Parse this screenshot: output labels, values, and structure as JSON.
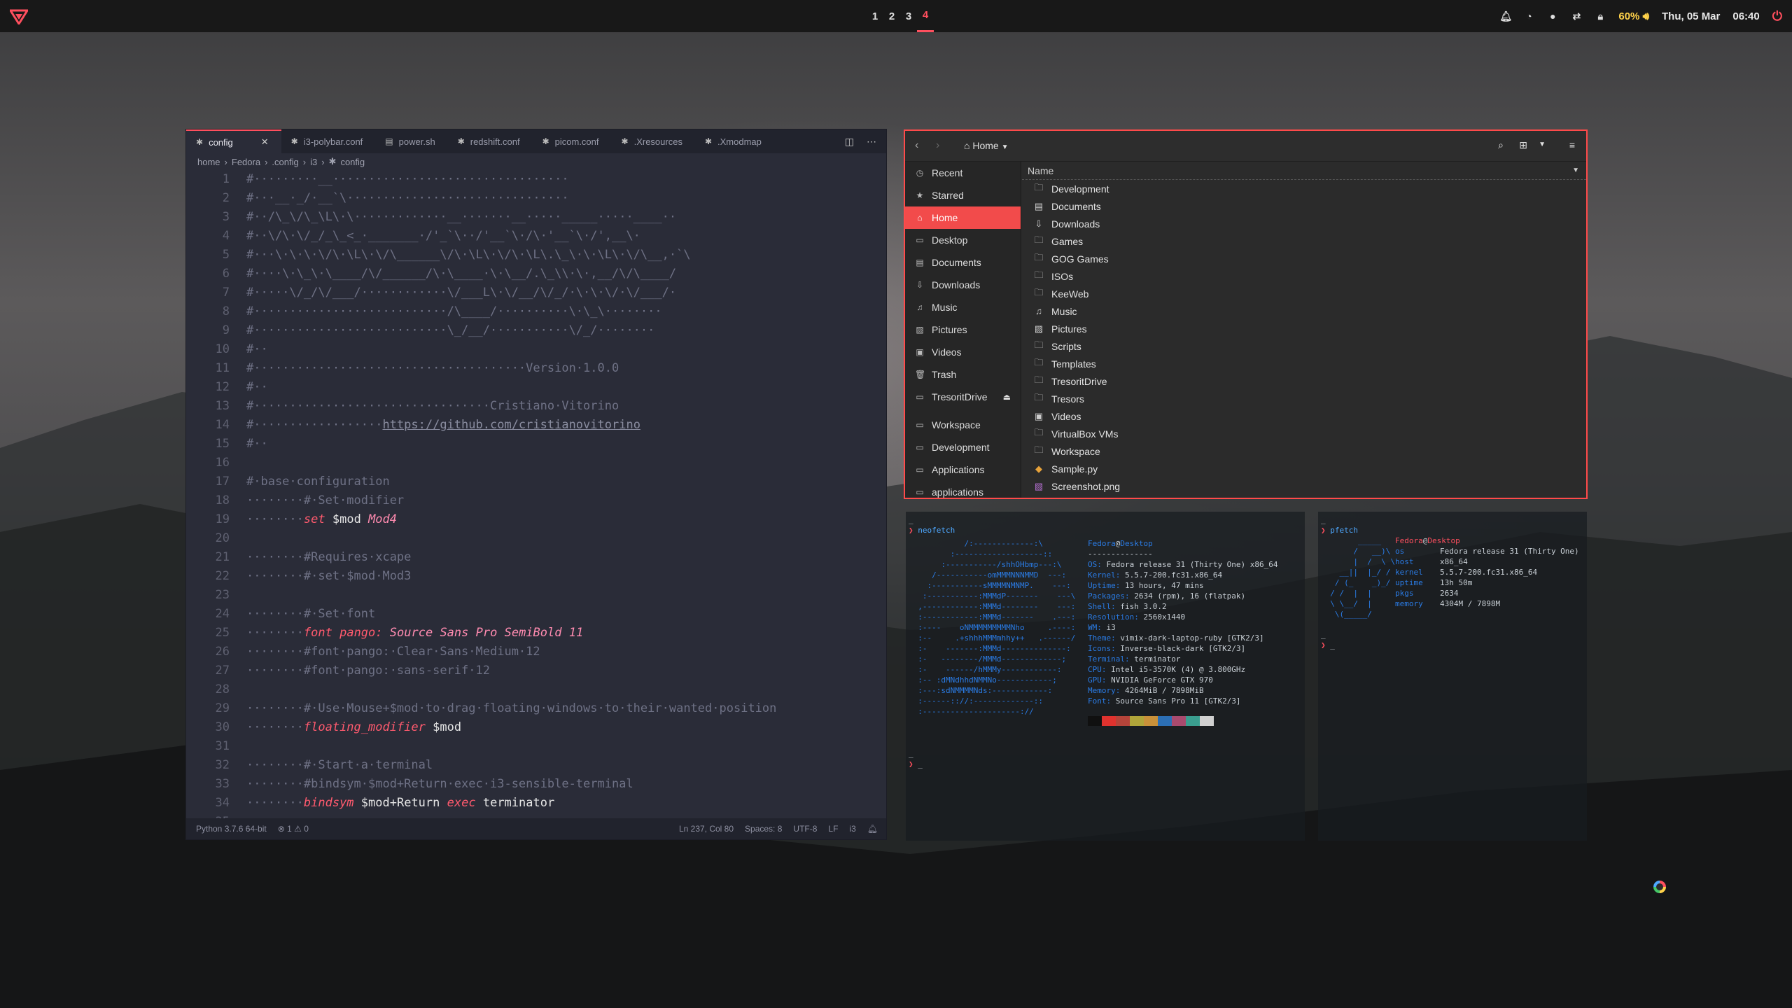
{
  "topbar": {
    "workspaces": [
      "1",
      "2",
      "3",
      "4"
    ],
    "active_workspace": "4",
    "tray_icons": [
      "bell-icon",
      "timer-icon",
      "circle-icon",
      "share-icon",
      "lock-icon"
    ],
    "volume": "60%",
    "date": "Thu, 05 Mar",
    "time": "06:40",
    "accent": "#ff4f5e"
  },
  "editor": {
    "tabs": [
      {
        "icon": "gear-icon",
        "label": "config",
        "active": true
      },
      {
        "icon": "gear-icon",
        "label": "i3-polybar.conf"
      },
      {
        "icon": "shell-icon",
        "label": "power.sh"
      },
      {
        "icon": "gear-icon",
        "label": "redshift.conf"
      },
      {
        "icon": "gear-icon",
        "label": "picom.conf"
      },
      {
        "icon": "gear-icon",
        "label": ".Xresources"
      },
      {
        "icon": "gear-icon",
        "label": ".Xmodmap"
      }
    ],
    "breadcrumb": [
      "home",
      "Fedora",
      ".config",
      "i3",
      "config"
    ],
    "lines": [
      {
        "n": "1",
        "text": "#·········__·································"
      },
      {
        "n": "2",
        "text": "#···__·_/·__`\\·······························"
      },
      {
        "n": "3",
        "text": "#··/\\_\\/\\_\\L\\·\\·············__·······__·····_____·····____··"
      },
      {
        "n": "4",
        "text": "#··\\/\\·\\/_/_\\_<_·_______·/'_`\\··/'__`\\·/\\·'__`\\·/',__\\·"
      },
      {
        "n": "5",
        "text": "#···\\·\\·\\·\\/\\·\\L\\·\\/\\______\\/\\·\\L\\·\\/\\·\\L\\.\\_\\·\\·\\L\\·\\/\\__,·`\\"
      },
      {
        "n": "6",
        "text": "#····\\·\\_\\·\\____/\\/______/\\·\\____·\\·\\__/.\\_\\\\·\\·,__/\\/\\____/"
      },
      {
        "n": "7",
        "text": "#·····\\/_/\\/___/············\\/___L\\·\\/__/\\/_/·\\·\\·\\/·\\/___/·"
      },
      {
        "n": "8",
        "text": "#···························/\\____/··········\\·\\_\\········"
      },
      {
        "n": "9",
        "text": "#···························\\_/__/···········\\/_/········"
      },
      {
        "n": "10",
        "text": "#··"
      },
      {
        "n": "11",
        "text": "#······································Version·1.0.0"
      },
      {
        "n": "12",
        "text": "#··"
      },
      {
        "n": "13",
        "text": "#·································Cristiano·Vitorino"
      },
      {
        "n": "14",
        "text": "#··················https://github.com/cristianovitorino"
      },
      {
        "n": "15",
        "text": "#··"
      },
      {
        "n": "16",
        "text": ""
      },
      {
        "n": "17",
        "text": "#·base·configuration"
      },
      {
        "n": "18",
        "text": "········#·Set·modifier"
      },
      {
        "n": "19",
        "text": "········set $mod Mod4"
      },
      {
        "n": "20",
        "text": ""
      },
      {
        "n": "21",
        "text": "········#Requires·xcape"
      },
      {
        "n": "22",
        "text": "········#·set·$mod·Mod3"
      },
      {
        "n": "23",
        "text": ""
      },
      {
        "n": "24",
        "text": "········#·Set·font"
      },
      {
        "n": "25",
        "text": "········font pango: Source Sans Pro SemiBold 11"
      },
      {
        "n": "26",
        "text": "········#font·pango:·Clear·Sans·Medium·12"
      },
      {
        "n": "27",
        "text": "········#font·pango:·sans-serif·12"
      },
      {
        "n": "28",
        "text": ""
      },
      {
        "n": "29",
        "text": "········#·Use·Mouse+$mod·to·drag·floating·windows·to·their·wanted·position"
      },
      {
        "n": "30",
        "text": "········floating_modifier $mod"
      },
      {
        "n": "31",
        "text": ""
      },
      {
        "n": "32",
        "text": "········#·Start·a·terminal"
      },
      {
        "n": "33",
        "text": "········#bindsym·$mod+Return·exec·i3-sensible-terminal"
      },
      {
        "n": "34",
        "text": "········bindsym $mod+Return exec terminator"
      },
      {
        "n": "35",
        "text": ""
      }
    ],
    "status": {
      "python": "Python 3.7.6 64-bit",
      "problems": "⊗ 1 ⚠ 0",
      "position": "Ln 237, Col 80",
      "spaces": "Spaces: 8",
      "encoding": "UTF-8",
      "eol": "LF",
      "lang": "i3"
    }
  },
  "filemanager": {
    "location": "Home",
    "sidebar": [
      {
        "icon": "clock-icon",
        "label": "Recent"
      },
      {
        "icon": "star-icon",
        "label": "Starred"
      },
      {
        "icon": "home-icon",
        "label": "Home",
        "active": true
      },
      {
        "icon": "desktop-icon",
        "label": "Desktop"
      },
      {
        "icon": "document-icon",
        "label": "Documents"
      },
      {
        "icon": "download-icon",
        "label": "Downloads"
      },
      {
        "icon": "music-icon",
        "label": "Music"
      },
      {
        "icon": "picture-icon",
        "label": "Pictures"
      },
      {
        "icon": "video-icon",
        "label": "Videos"
      },
      {
        "icon": "trash-icon",
        "label": "Trash"
      },
      {
        "icon": "drive-icon",
        "label": "TresoritDrive",
        "eject": true
      },
      {
        "icon": "folder-icon",
        "label": "Workspace"
      },
      {
        "icon": "folder-icon",
        "label": "Development"
      },
      {
        "icon": "folder-icon",
        "label": "Applications"
      },
      {
        "icon": "folder-icon",
        "label": "applications"
      }
    ],
    "column": "Name",
    "files": [
      {
        "icon": "folder-icon",
        "name": "Development"
      },
      {
        "icon": "document-folder-icon",
        "name": "Documents"
      },
      {
        "icon": "download-folder-icon",
        "name": "Downloads"
      },
      {
        "icon": "folder-icon",
        "name": "Games"
      },
      {
        "icon": "folder-icon",
        "name": "GOG Games"
      },
      {
        "icon": "folder-icon",
        "name": "ISOs"
      },
      {
        "icon": "folder-icon",
        "name": "KeeWeb"
      },
      {
        "icon": "music-folder-icon",
        "name": "Music"
      },
      {
        "icon": "picture-folder-icon",
        "name": "Pictures"
      },
      {
        "icon": "folder-icon",
        "name": "Scripts"
      },
      {
        "icon": "folder-icon",
        "name": "Templates"
      },
      {
        "icon": "folder-icon",
        "name": "TresoritDrive"
      },
      {
        "icon": "folder-icon",
        "name": "Tresors"
      },
      {
        "icon": "video-folder-icon",
        "name": "Videos"
      },
      {
        "icon": "folder-icon",
        "name": "VirtualBox VMs"
      },
      {
        "icon": "folder-icon",
        "name": "Workspace"
      },
      {
        "icon": "python-file-icon",
        "name": "Sample.py"
      },
      {
        "icon": "image-file-icon",
        "name": "Screenshot.png"
      }
    ]
  },
  "terminal1": {
    "command": "neofetch",
    "ascii": [
      "            /:-------------:\\",
      "         :-------------------::",
      "       :-----------/shhOHbmp---:\\",
      "     /-----------omMMMNNNMMD  ---:",
      "    :-----------sMMMMNMNMP.    ---:",
      "   :-----------:MMMdP-------    ---\\",
      "  ,------------:MMMd--------    ---:",
      "  :------------:MMMd-------    .---:",
      "  :----    oNMMMMMMMMMNho     .----:",
      "  :--     .+shhhMMMmhhy++   .------/",
      "  :-    -------:MMMd--------------:",
      "  :-   --------/MMMd-------------;",
      "  :-    ------/hMMMy------------:",
      "  :-- :dMNdhhdNMMNo------------;",
      "  :---:sdNMMMMNds:------------:",
      "  :------:://:-------------::",
      "  :---------------------://"
    ],
    "user": "Fedora",
    "host": "Desktop",
    "separator": "--------------",
    "info": [
      {
        "k": "OS",
        "v": "Fedora release 31 (Thirty One) x86_64"
      },
      {
        "k": "Kernel",
        "v": "5.5.7-200.fc31.x86_64"
      },
      {
        "k": "Uptime",
        "v": "13 hours, 47 mins"
      },
      {
        "k": "Packages",
        "v": "2634 (rpm), 16 (flatpak)"
      },
      {
        "k": "Shell",
        "v": "fish 3.0.2"
      },
      {
        "k": "Resolution",
        "v": "2560x1440"
      },
      {
        "k": "WM",
        "v": "i3"
      },
      {
        "k": "Theme",
        "v": "vimix-dark-laptop-ruby [GTK2/3]"
      },
      {
        "k": "Icons",
        "v": "Inverse-black-dark [GTK2/3]"
      },
      {
        "k": "Terminal",
        "v": "terminator"
      },
      {
        "k": "CPU",
        "v": "Intel i5-3570K (4) @ 3.800GHz"
      },
      {
        "k": "GPU",
        "v": "NVIDIA GeForce GTX 970"
      },
      {
        "k": "Memory",
        "v": "4264MiB / 7898MiB"
      },
      {
        "k": "Font",
        "v": "Source Sans Pro 11 [GTK2/3]"
      }
    ],
    "swatches": [
      "#101010",
      "#e0322e",
      "#b5443a",
      "#b0a53a",
      "#c9913a",
      "#2c6fb5",
      "#a94a6e",
      "#3a9e8f",
      "#d0d0d0"
    ]
  },
  "terminal2": {
    "command": "pfetch",
    "ascii": [
      "        _____",
      "       /   __)\\",
      "       |  /  \\ \\",
      "    __||  |_/ /",
      "   / (_    _)_/",
      "  / /  |  |",
      "  \\ \\__/  |",
      "   \\(_____/"
    ],
    "user": "Fedora",
    "host": "Desktop",
    "info": [
      {
        "k": "os",
        "v": "Fedora release 31 (Thirty One)"
      },
      {
        "k": "host",
        "v": "x86_64"
      },
      {
        "k": "kernel",
        "v": "5.5.7-200.fc31.x86_64"
      },
      {
        "k": "uptime",
        "v": "13h 50m"
      },
      {
        "k": "pkgs",
        "v": "2634"
      },
      {
        "k": "memory",
        "v": "4304M / 7898M"
      }
    ]
  }
}
